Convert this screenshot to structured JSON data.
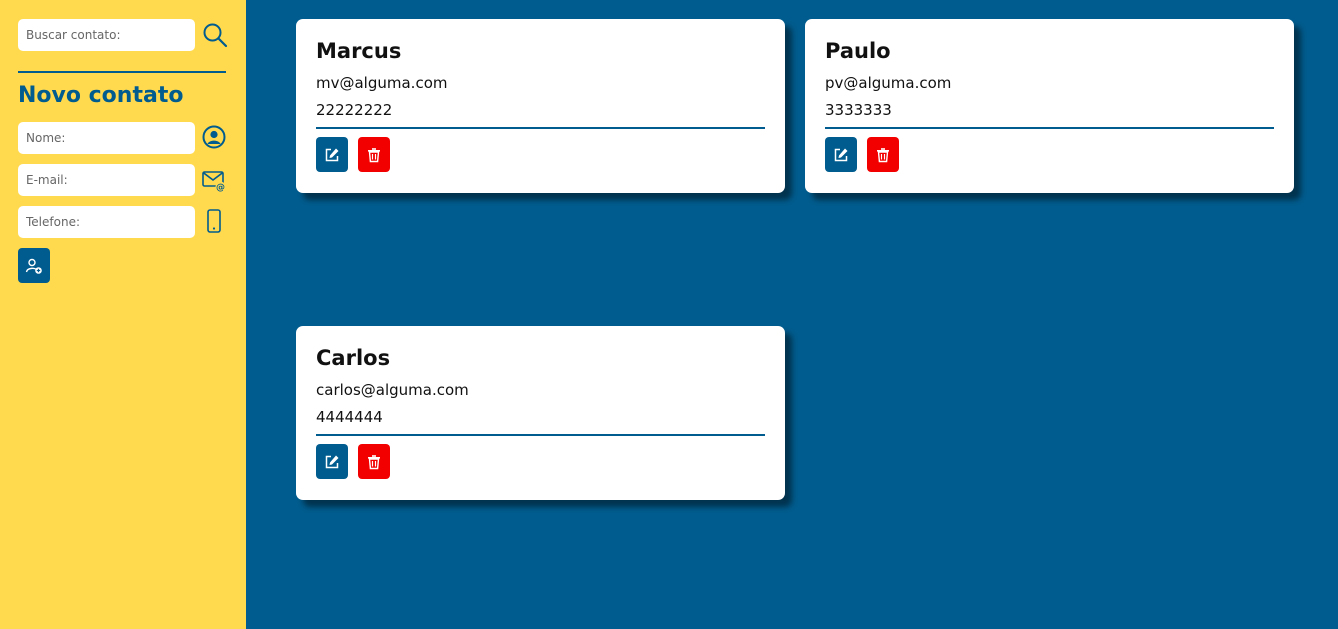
{
  "sidebar": {
    "search_placeholder": "Buscar contato:",
    "search_icon": "search-icon",
    "form_title": "Novo contato",
    "name_placeholder": "Nome:",
    "email_placeholder": "E-mail:",
    "phone_placeholder": "Telefone:",
    "name_icon": "user-circle-icon",
    "email_icon": "envelope-at-icon",
    "phone_icon": "smartphone-icon",
    "add_icon": "add-user-icon"
  },
  "colors": {
    "primary": "#005c8e",
    "sidebar_bg": "#ffda4f",
    "delete": "#f20000"
  },
  "contacts": [
    {
      "name": "Marcus",
      "email": "mv@alguma.com",
      "phone": "22222222"
    },
    {
      "name": "Paulo",
      "email": "pv@alguma.com",
      "phone": "3333333"
    },
    {
      "name": "Carlos",
      "email": "carlos@alguma.com",
      "phone": "4444444"
    }
  ]
}
